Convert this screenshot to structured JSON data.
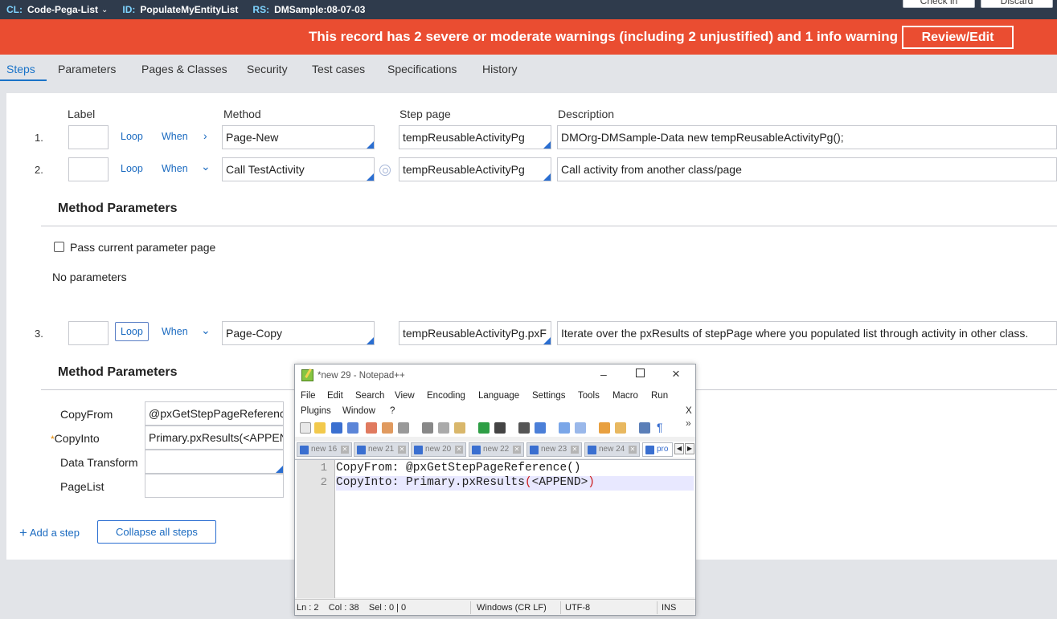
{
  "header": {
    "cl_label": "CL:",
    "cl_value": "Code-Pega-List",
    "id_label": "ID:",
    "id_value": "PopulateMyEntityList",
    "rs_label": "RS:",
    "rs_value": "DMSample:08-07-03",
    "checkin_label": "Check in",
    "discard_label": "Discard"
  },
  "banner": {
    "text": "This record has 2 severe or moderate warnings (including 2 unjustified) and 1 info warning",
    "button": "Review/Edit"
  },
  "tabs": [
    "Steps",
    "Parameters",
    "Pages & Classes",
    "Security",
    "Test cases",
    "Specifications",
    "History"
  ],
  "columns": {
    "label": "Label",
    "method": "Method",
    "step_page": "Step page",
    "description": "Description"
  },
  "steps": [
    {
      "num": "1.",
      "loop": "Loop",
      "when": "When",
      "method": "Page-New",
      "step_page": "tempReusableActivityPg",
      "description": "DMOrg-DMSample-Data new tempReusableActivityPg();"
    },
    {
      "num": "2.",
      "loop": "Loop",
      "when": "When",
      "method": "Call TestActivity",
      "step_page": "tempReusableActivityPg",
      "description": "Call activity from another class/page"
    },
    {
      "num": "3.",
      "loop": "Loop",
      "when": "When",
      "method": "Page-Copy",
      "step_page": "tempReusableActivityPg.pxF",
      "description": "Iterate over the pxResults of stepPage where you populated list through activity in other class."
    }
  ],
  "method_params_title": "Method Parameters",
  "step2_params": {
    "pass_current": "Pass current parameter page",
    "no_params": "No parameters"
  },
  "step3_params": {
    "rows": [
      {
        "label": "CopyFrom",
        "value": "@pxGetStepPageReferenc"
      },
      {
        "label": "CopyInto",
        "value": "Primary.pxResults(<APPEN",
        "required": "*"
      },
      {
        "label": "Data Transform",
        "value": ""
      },
      {
        "label": "PageList",
        "value": ""
      }
    ]
  },
  "actions": {
    "add_step": "Add a step",
    "collapse": "Collapse all steps"
  },
  "notepad": {
    "title": "*new 29 - Notepad++",
    "menu": [
      "File",
      "Edit",
      "Search",
      "View",
      "Encoding",
      "Language",
      "Settings",
      "Tools",
      "Macro",
      "Run",
      "Plugins",
      "Window",
      "?"
    ],
    "menu_close": "X",
    "toolbar_more": "»",
    "tabs": [
      "new 16",
      "new 21",
      "new 20",
      "new 22",
      "new 23",
      "new 24",
      "pro"
    ],
    "lines": [
      {
        "n": "1",
        "text": "CopyFrom: @pxGetStepPageReference()"
      },
      {
        "n": "2",
        "prefix": "CopyInto: Primary.pxResults",
        "open": "(",
        "middle": "<APPEND>",
        "close": ")"
      }
    ],
    "status": {
      "pos": "Ln : 2    Col : 38    Sel : 0 | 0",
      "eol": "Windows (CR LF)",
      "enc": "UTF-8",
      "mode": "INS"
    }
  }
}
